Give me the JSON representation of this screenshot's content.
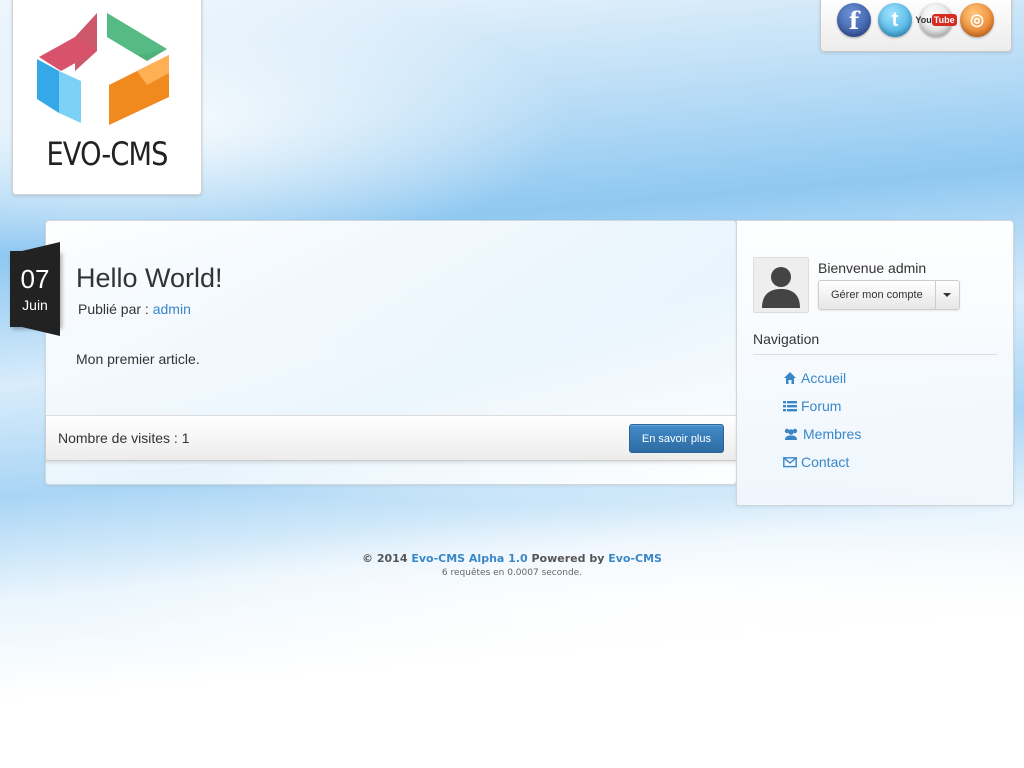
{
  "logo": {
    "text": "EVO-CMS"
  },
  "social": {
    "facebook_glyph": "f",
    "twitter_glyph": "t",
    "youtube_glyph_a": "You",
    "youtube_glyph_b": "Tube",
    "rss_glyph": "◎",
    "icons": [
      "facebook-icon",
      "twitter-icon",
      "youtube-icon",
      "rss-icon"
    ]
  },
  "post": {
    "day": "07",
    "month": "Juin",
    "title": "Hello World!",
    "meta_label": "Publié par :",
    "author": "admin",
    "body": "Mon premier article.",
    "visits_text": "Nombre de visites : 1",
    "more_label": "En savoir plus"
  },
  "sidebar": {
    "welcome": "Bienvenue admin",
    "account_label": "Gérer mon compte",
    "nav_heading": "Navigation",
    "nav_items": [
      {
        "label": "Accueil",
        "icon": "home-icon"
      },
      {
        "label": "Forum",
        "icon": "list-icon"
      },
      {
        "label": "Membres",
        "icon": "users-icon"
      },
      {
        "label": "Contact",
        "icon": "envelope-icon"
      }
    ]
  },
  "footer": {
    "copyright": "© 2014",
    "product": "Evo-CMS Alpha 1.0",
    "powered_by": "Powered by",
    "powered_link": "Evo-CMS",
    "stats": "6 requêtes en 0.0007 seconde."
  },
  "colors": {
    "link": "#3a87c8",
    "primary_button": "#428bca",
    "date_badge": "#222222"
  }
}
